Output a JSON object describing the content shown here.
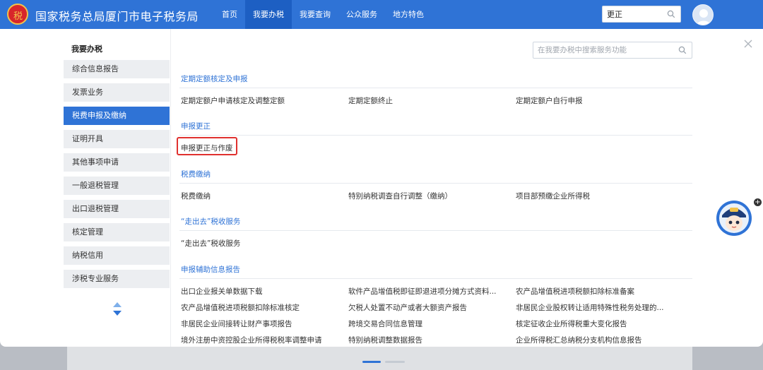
{
  "header": {
    "emblem_text": "税",
    "site_title": "国家税务总局厦门市电子税务局",
    "nav": [
      {
        "label": "首页"
      },
      {
        "label": "我要办税"
      },
      {
        "label": "我要查询"
      },
      {
        "label": "公众服务"
      },
      {
        "label": "地方特色"
      }
    ],
    "active_nav": "我要办税",
    "search_value": "更正"
  },
  "sidebar": {
    "title": "我要办税",
    "items": [
      {
        "label": "综合信息报告"
      },
      {
        "label": "发票业务"
      },
      {
        "label": "税费申报及缴纳"
      },
      {
        "label": "证明开具"
      },
      {
        "label": "其他事项申请"
      },
      {
        "label": "一般退税管理"
      },
      {
        "label": "出口退税管理"
      },
      {
        "label": "核定管理"
      },
      {
        "label": "纳税信用"
      },
      {
        "label": "涉税专业服务"
      }
    ],
    "active_item": "税费申报及缴纳"
  },
  "content": {
    "search_placeholder": "在我要办税中搜索服务功能",
    "sections": [
      {
        "title": "定期定额核定及申报",
        "items": [
          "定期定额户申请核定及调整定额",
          "定期定额终止",
          "定期定额户自行申报"
        ]
      },
      {
        "title": "申报更正",
        "items": [
          "申报更正与作废"
        ]
      },
      {
        "title": "税费缴纳",
        "items": [
          "税费缴纳",
          "特别纳税调查自行调整（缴纳）",
          "项目部预缴企业所得税"
        ]
      },
      {
        "title": "“走出去”税收服务",
        "items": [
          "“走出去”税收服务"
        ]
      },
      {
        "title": "申报辅助信息报告",
        "items": [
          "出口企业报关单数据下载",
          "软件产品增值税即征即退进项分摊方式资料...",
          "农产品增值税进项税额扣除标准备案",
          "农产品增值税进项税额扣除标准核定",
          "欠税人处置不动产或者大额资产报告",
          "非居民企业股权转让适用特殊性税务处理的...",
          "非居民企业间接转让财产事项报告",
          "跨境交易合同信息管理",
          "核定征收企业所得税重大变化报告",
          "境外注册中资控股企业所得税税率调整申请",
          "特别纳税调整数据报告",
          "企业所得税汇总纳税分支机构信息报告"
        ]
      }
    ],
    "highlighted_item": "申报更正与作废"
  },
  "colors": {
    "brand_blue": "#2f73d6",
    "nav_active": "#1d5fc3",
    "highlight_red": "#e0312f",
    "sidebar_bg": "#eceef1"
  },
  "icons": [
    "search-icon",
    "close-icon",
    "emblem-icon",
    "user-avatar-icon",
    "scroll-arrows-icon",
    "mascot-icon",
    "plus-icon"
  ]
}
